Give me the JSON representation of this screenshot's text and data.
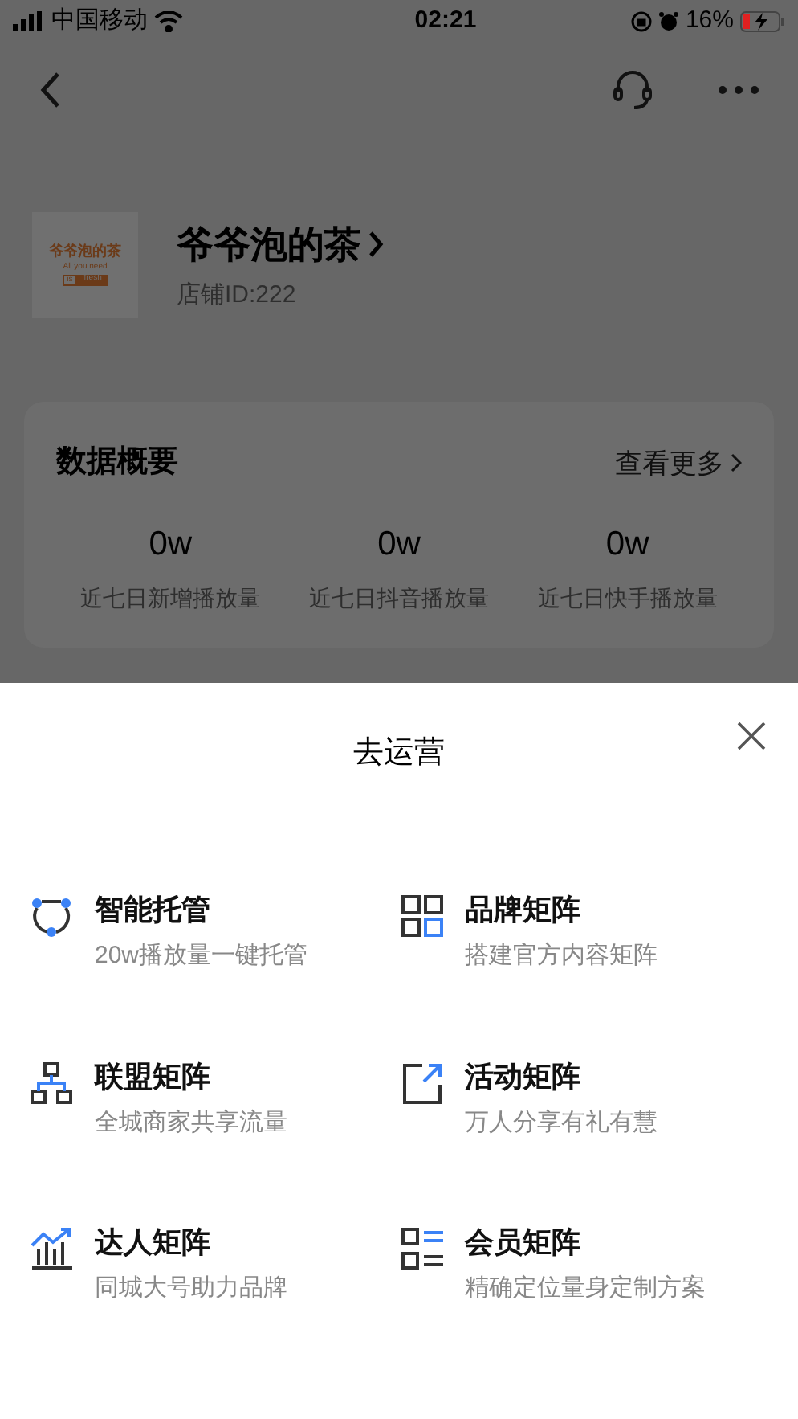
{
  "status_bar": {
    "carrier": "中国移动",
    "time": "02:21",
    "battery": "16%"
  },
  "shop": {
    "logo": {
      "name": "爷爷泡的茶",
      "tagline": "All you need",
      "tag_left": "is",
      "tag_right": "fresh"
    },
    "name": "爷爷泡的茶",
    "id": "店铺ID:222"
  },
  "summary": {
    "title": "数据概要",
    "more": "查看更多",
    "stats": [
      {
        "value": "0w",
        "label": "近七日新增播放量"
      },
      {
        "value": "0w",
        "label": "近七日抖音播放量"
      },
      {
        "value": "0w",
        "label": "近七日快手播放量"
      }
    ]
  },
  "sheet": {
    "title": "去运营",
    "items": [
      {
        "title": "智能托管",
        "subtitle": "20w播放量一键托管"
      },
      {
        "title": "品牌矩阵",
        "subtitle": "搭建官方内容矩阵"
      },
      {
        "title": "联盟矩阵",
        "subtitle": "全城商家共享流量"
      },
      {
        "title": "活动矩阵",
        "subtitle": "万人分享有礼有慧"
      },
      {
        "title": "达人矩阵",
        "subtitle": "同城大号助力品牌"
      },
      {
        "title": "会员矩阵",
        "subtitle": "精确定位量身定制方案"
      }
    ]
  }
}
